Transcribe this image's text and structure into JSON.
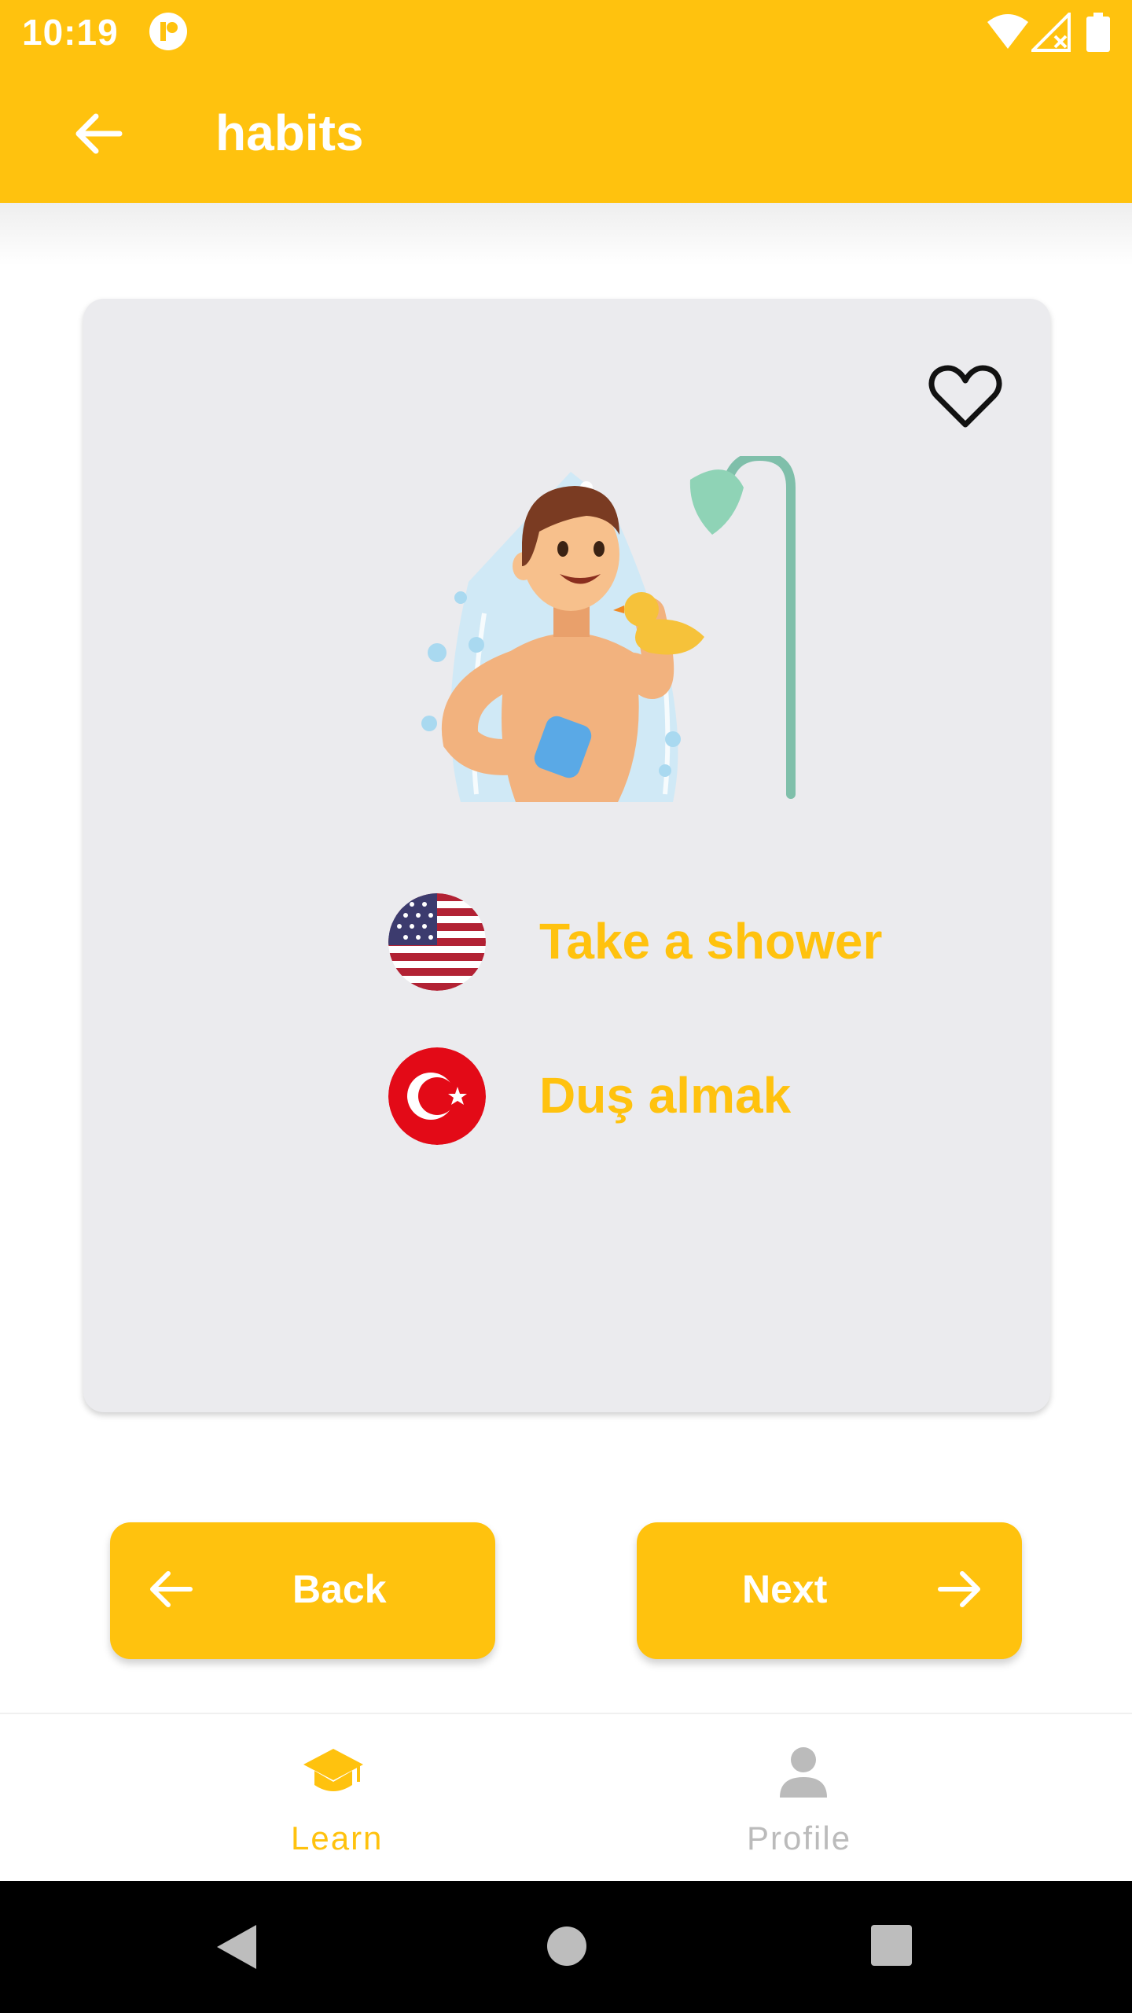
{
  "status_bar": {
    "time": "10:19",
    "icons": [
      "app-notification-icon",
      "wifi-icon",
      "signal-icon",
      "battery-icon"
    ]
  },
  "app_bar": {
    "title": "habits",
    "back_icon": "arrow-left-icon"
  },
  "card": {
    "favorite_icon": "heart-outline-icon",
    "illustration": "boy-taking-shower-illustration",
    "entries": [
      {
        "flag": "us-flag-icon",
        "text": "Take a shower"
      },
      {
        "flag": "turkey-flag-icon",
        "text": "Duş almak"
      }
    ]
  },
  "buttons": {
    "back_label": "Back",
    "next_label": "Next"
  },
  "bottom_nav": {
    "items": [
      {
        "label": "Learn",
        "icon": "graduation-cap-icon",
        "active": true
      },
      {
        "label": "Profile",
        "icon": "person-icon",
        "active": false
      }
    ]
  },
  "colors": {
    "primary": "#FFC20E",
    "card_background": "#EBEBEE",
    "inactive": "#BBBBBB"
  }
}
